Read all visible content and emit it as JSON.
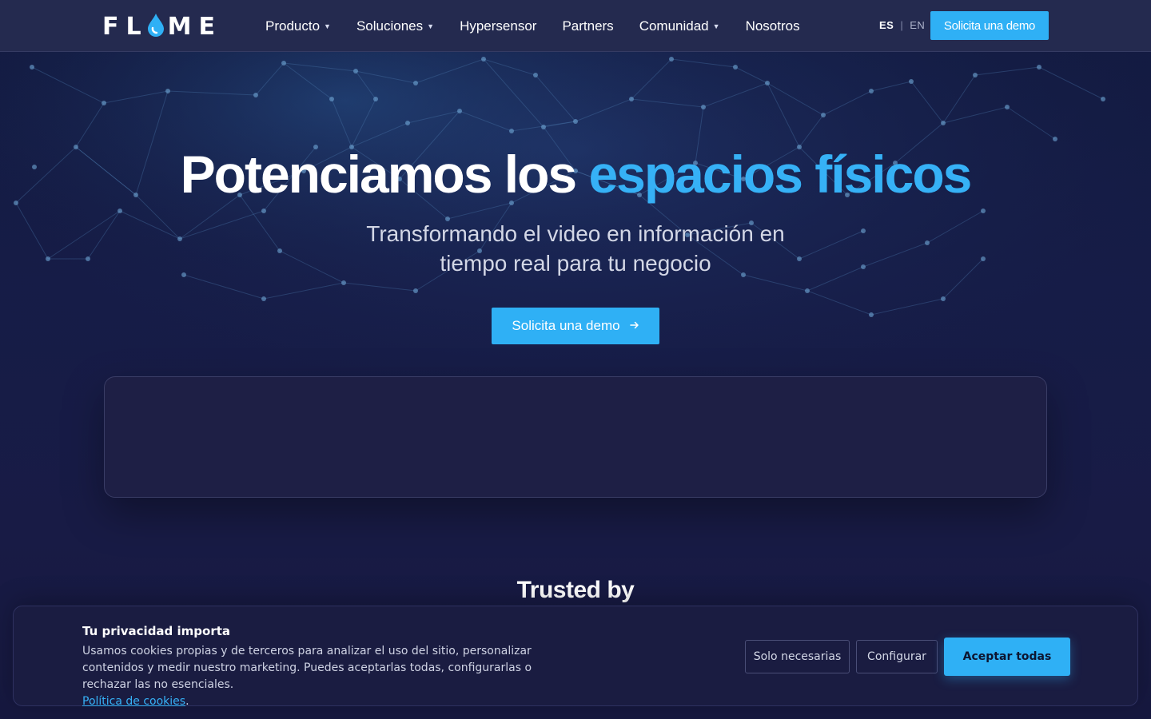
{
  "brand": {
    "logo_left": "FL",
    "logo_right": "ME",
    "accent_color": "#36b1f6",
    "logo_icon": "water-drop-icon"
  },
  "nav": {
    "items": [
      {
        "label": "Producto",
        "has_dropdown": true
      },
      {
        "label": "Soluciones",
        "has_dropdown": true
      },
      {
        "label": "Hypersensor",
        "has_dropdown": false
      },
      {
        "label": "Partners",
        "has_dropdown": false
      },
      {
        "label": "Comunidad",
        "has_dropdown": true
      },
      {
        "label": "Nosotros",
        "has_dropdown": false
      }
    ],
    "lang_active": "ES",
    "lang_separator": "|",
    "lang_inactive": "EN",
    "cta_label": "Solicita una demo"
  },
  "hero": {
    "title_white": "Potenciamos los ",
    "title_blue": "espacios físicos",
    "subtitle_line1": "Transformando el video en información en",
    "subtitle_line2": "tiempo real para tu negocio",
    "cta_label": "Solicita una demo",
    "cta_icon": "arrow-right-icon"
  },
  "trusted": {
    "heading": "Trusted by"
  },
  "cookie_banner": {
    "title": "Tu privacidad importa",
    "text": "Usamos cookies propias y de terceros para analizar el uso del sitio, personalizar contenidos y medir nuestro marketing. Puedes aceptarlas todas, configurarlas o rechazar las no esenciales.",
    "policy_link": "Política de cookies",
    "policy_suffix": ".",
    "btn_necessary": "Solo necesarias",
    "btn_configure": "Configurar",
    "btn_accept": "Aceptar todas"
  }
}
